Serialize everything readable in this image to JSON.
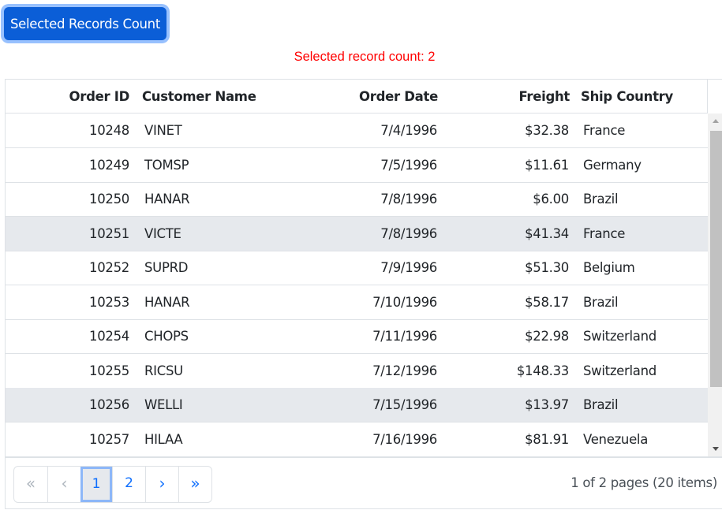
{
  "toolbar": {
    "button_label": "Selected Records Count"
  },
  "status": {
    "selected_count_text": "Selected record count: 2"
  },
  "grid": {
    "columns": [
      "Order ID",
      "Customer Name",
      "Order Date",
      "Freight",
      "Ship Country"
    ],
    "rows": [
      {
        "id": "10248",
        "name": "VINET",
        "date": "7/4/1996",
        "freight": "$32.38",
        "country": "France",
        "selected": false
      },
      {
        "id": "10249",
        "name": "TOMSP",
        "date": "7/5/1996",
        "freight": "$11.61",
        "country": "Germany",
        "selected": false
      },
      {
        "id": "10250",
        "name": "HANAR",
        "date": "7/8/1996",
        "freight": "$6.00",
        "country": "Brazil",
        "selected": false
      },
      {
        "id": "10251",
        "name": "VICTE",
        "date": "7/8/1996",
        "freight": "$41.34",
        "country": "France",
        "selected": true
      },
      {
        "id": "10252",
        "name": "SUPRD",
        "date": "7/9/1996",
        "freight": "$51.30",
        "country": "Belgium",
        "selected": false
      },
      {
        "id": "10253",
        "name": "HANAR",
        "date": "7/10/1996",
        "freight": "$58.17",
        "country": "Brazil",
        "selected": false
      },
      {
        "id": "10254",
        "name": "CHOPS",
        "date": "7/11/1996",
        "freight": "$22.98",
        "country": "Switzerland",
        "selected": false
      },
      {
        "id": "10255",
        "name": "RICSU",
        "date": "7/12/1996",
        "freight": "$148.33",
        "country": "Switzerland",
        "selected": false
      },
      {
        "id": "10256",
        "name": "WELLI",
        "date": "7/15/1996",
        "freight": "$13.97",
        "country": "Brazil",
        "selected": true
      },
      {
        "id": "10257",
        "name": "HILAA",
        "date": "7/16/1996",
        "freight": "$81.91",
        "country": "Venezuela",
        "selected": false
      }
    ]
  },
  "pager": {
    "first_icon": "«",
    "prev_icon": "‹",
    "pages": [
      "1",
      "2"
    ],
    "current_page": "1",
    "next_icon": "›",
    "last_icon": "»",
    "info": "1 of 2 pages (20 items)"
  }
}
